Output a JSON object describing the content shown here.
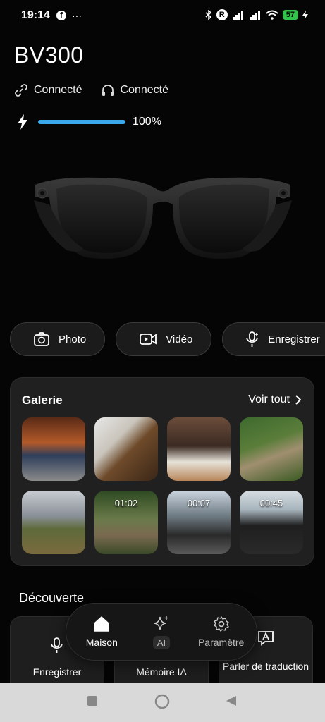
{
  "status_bar": {
    "time": "19:14",
    "dots": "···",
    "facebook_letter": "f",
    "r_badge": "R",
    "battery": "57"
  },
  "device": {
    "name": "BV300",
    "link_status": "Connecté",
    "audio_status": "Connecté",
    "battery_level_percent": 100,
    "battery_label": "100%"
  },
  "actions": {
    "photo": "Photo",
    "video": "Vidéo",
    "record": "Enregistrer"
  },
  "gallery": {
    "title": "Galerie",
    "see_all": "Voir tout",
    "items": [
      {
        "duration": ""
      },
      {
        "duration": ""
      },
      {
        "duration": ""
      },
      {
        "duration": ""
      },
      {
        "duration": ""
      },
      {
        "duration": "01:02"
      },
      {
        "duration": "00:07"
      },
      {
        "duration": "00:45"
      }
    ]
  },
  "discover": {
    "title": "Découverte",
    "cards": [
      {
        "label": "Enregistrer"
      },
      {
        "label": "Mémoire IA"
      },
      {
        "label": "Parler de traduction"
      }
    ]
  },
  "bottom_nav": {
    "home": "Maison",
    "ai": "AI",
    "settings": "Paramètre"
  },
  "colors": {
    "accent": "#39a9ea",
    "background": "#050505",
    "card": "#202020"
  }
}
